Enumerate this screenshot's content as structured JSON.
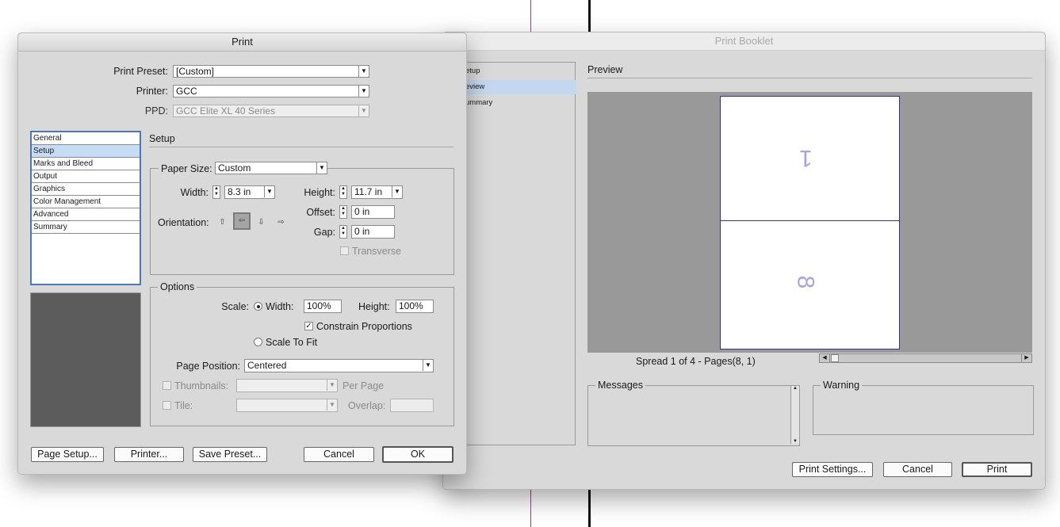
{
  "print_dialog": {
    "title": "Print",
    "preset_label": "Print Preset:",
    "preset_value": "[Custom]",
    "printer_label": "Printer:",
    "printer_value": "GCC",
    "ppd_label": "PPD:",
    "ppd_value": "GCC Elite XL 40 Series",
    "categories": [
      "General",
      "Setup",
      "Marks and Bleed",
      "Output",
      "Graphics",
      "Color Management",
      "Advanced",
      "Summary"
    ],
    "selected_category": "Setup",
    "section_title": "Setup",
    "paper_size_label": "Paper Size:",
    "paper_size_value": "Custom",
    "width_label": "Width:",
    "width_value": "8.3 in",
    "height_label": "Height:",
    "height_value": "11.7 in",
    "orientation_label": "Orientation:",
    "offset_label": "Offset:",
    "offset_value": "0 in",
    "gap_label": "Gap:",
    "gap_value": "0 in",
    "transverse_label": "Transverse",
    "options_title": "Options",
    "scale_label": "Scale:",
    "scale_width_label": "Width:",
    "scale_width_value": "100%",
    "scale_height_label": "Height:",
    "scale_height_value": "100%",
    "constrain_label": "Constrain Proportions",
    "scale_to_fit_label": "Scale To Fit",
    "page_position_label": "Page Position:",
    "page_position_value": "Centered",
    "thumbnails_label": "Thumbnails:",
    "per_page_label": "Per Page",
    "tile_label": "Tile:",
    "overlap_label": "Overlap:",
    "buttons": {
      "page_setup": "Page Setup...",
      "printer": "Printer...",
      "save_preset": "Save Preset...",
      "cancel": "Cancel",
      "ok": "OK"
    }
  },
  "booklet_dialog": {
    "title": "Print Booklet",
    "nav_items": [
      "etup",
      "eview",
      "ummary"
    ],
    "selected_nav": "eview",
    "preview_title": "Preview",
    "page_top": "1",
    "page_bottom": "8",
    "spread_text": "Spread 1 of 4 - Pages(8, 1)",
    "messages_title": "Messages",
    "warning_title": "Warning",
    "buttons": {
      "print_settings": "Print Settings...",
      "cancel": "Cancel",
      "print": "Print"
    }
  },
  "colors": {
    "selection": "#c6dbf4",
    "list_border": "#4b79b8",
    "page_number": "#a9a5dc",
    "preview_bg": "#999999"
  }
}
